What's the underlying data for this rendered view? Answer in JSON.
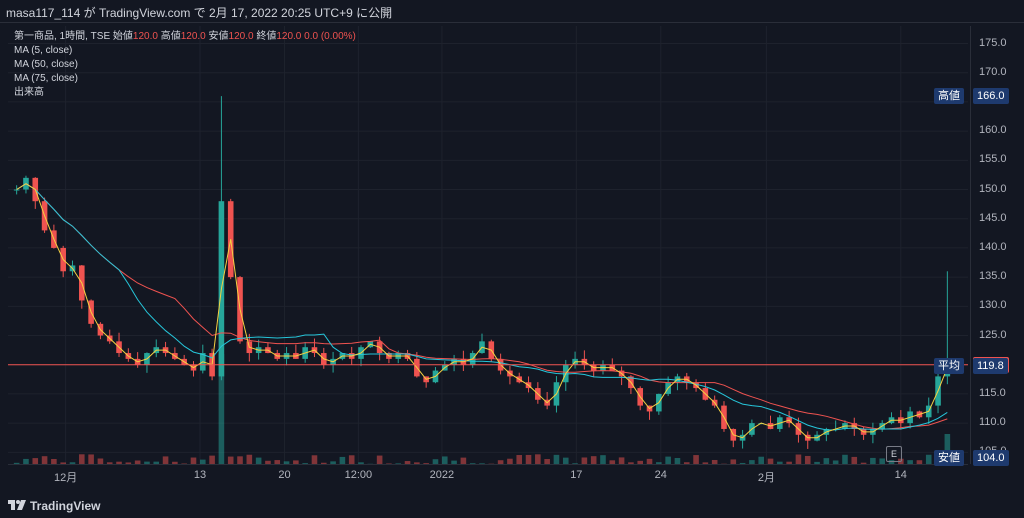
{
  "header": {
    "text": "masa117_114 が TradingView.com で 2月 17, 2022 20:25 UTC+9 に公開"
  },
  "legend": {
    "symbol_line_prefix": "第一商品, 1時間, TSE",
    "open_label": "始値",
    "open_value": "120.0",
    "high_label": "高値",
    "high_value": "120.0",
    "low_label": "安値",
    "low_value": "120.0",
    "close_label": "終値",
    "close_value": "120.0",
    "change": "0.0 (0.00%)",
    "ma5": "MA (5, close)",
    "ma50": "MA (50, close)",
    "ma75": "MA (75, close)",
    "volume": "出来高"
  },
  "price_axis": {
    "ticks": [
      "175.0",
      "170.0",
      "165.0",
      "160.0",
      "155.0",
      "150.0",
      "145.0",
      "140.0",
      "135.0",
      "130.0",
      "125.0",
      "120.0",
      "115.0",
      "110.0",
      "105.0"
    ],
    "high_label": "高値",
    "high_value": "166.0",
    "last_value": "120.0",
    "avg_label": "平均",
    "avg_value": "119.8",
    "low_label": "安値",
    "low_value": "104.0"
  },
  "time_axis": {
    "labels": [
      "12月",
      "13",
      "20",
      "12:00",
      "2022",
      "17",
      "24",
      "2月",
      "14"
    ]
  },
  "footer": {
    "brand": "TradingView"
  },
  "e_badge": "E",
  "colors": {
    "background": "#131722",
    "up": "#26a69a",
    "down": "#ef5350",
    "ma5": "#f5d142",
    "ma50": "#26c6da",
    "ma75": "#ef5350",
    "axis_badge_blue": "#1e3a6e",
    "last_price_red": "#ef5350"
  },
  "chart_data": {
    "type": "candlestick",
    "ylim": [
      103,
      178
    ],
    "ohlc_close_path": [
      150,
      152,
      148,
      143,
      140,
      136,
      137,
      131,
      127,
      125,
      124,
      122,
      121,
      120,
      122,
      123,
      122,
      121,
      120,
      119,
      122,
      118,
      148,
      135,
      124,
      122,
      123,
      122,
      121,
      122,
      121,
      123,
      122,
      120,
      121,
      122,
      121,
      123,
      124,
      122,
      121,
      122,
      121,
      118,
      117,
      119,
      120,
      121,
      120,
      122,
      124,
      121,
      119,
      118,
      117,
      116,
      114,
      113,
      117,
      120,
      121,
      120,
      119,
      120,
      119,
      118,
      116,
      113,
      112,
      115,
      117,
      118,
      117,
      116,
      114,
      113,
      109,
      107,
      108,
      110,
      110,
      109,
      111,
      110,
      108,
      107,
      108,
      109,
      109,
      110,
      109,
      108,
      109,
      110,
      111,
      110,
      112,
      111,
      113,
      118,
      121
    ],
    "ma_labels": [
      "MA (5, close)",
      "MA (50, close)",
      "MA (75, close)"
    ],
    "last_price": 120.0,
    "average": 119.8,
    "high": 166.0,
    "low": 104.0
  }
}
